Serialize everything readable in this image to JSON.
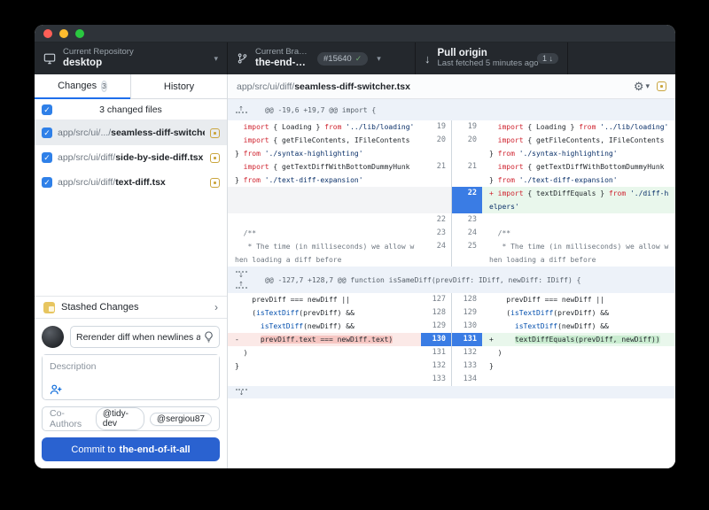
{
  "colors": {
    "accent_blue": "#1f6feb",
    "commit_button_blue": "#2a62d0",
    "added_bg": "#e9f7ec",
    "deleted_bg": "#fbe9e7",
    "modified_icon_yellow": "#caa53d",
    "line_number_highlight": "#3a7ce4",
    "toolbar_bg": "#24282d"
  },
  "icons": {
    "gear": "⚙",
    "caret_down": "▾",
    "chevron_right": "›",
    "check": "✓",
    "arrow_down": "↓",
    "arrow_up": "↑"
  },
  "toolbar": {
    "repo": {
      "label": "Current Repository",
      "value": "desktop"
    },
    "branch": {
      "label": "Current Bra…",
      "value": "the-end-of…",
      "pr_number": "#15640"
    },
    "pull": {
      "title": "Pull origin",
      "subtitle": "Last fetched 5 minutes ago",
      "badge_count": "1"
    }
  },
  "sidebar": {
    "tabs": {
      "changes": "Changes",
      "changes_badge": "3",
      "history": "History"
    },
    "files_header": "3 changed files",
    "files": [
      {
        "path_dim": "app/src/ui/.../",
        "path_file": "seamless-diff-switcher.tsx",
        "selected": true
      },
      {
        "path_dim": "app/src/ui/diff/",
        "path_file": "side-by-side-diff.tsx",
        "selected": false
      },
      {
        "path_dim": "app/src/ui/diff/",
        "path_file": "text-diff.tsx",
        "selected": false
      }
    ],
    "stash": {
      "label": "Stashed Changes"
    }
  },
  "commit": {
    "summary_value": "Rerender diff when newlines are adde",
    "description_placeholder": "Description",
    "coauthors_label": "Co-Authors",
    "coauthors": [
      "@tidy-dev",
      "@sergiou87"
    ],
    "button_prefix": "Commit to",
    "button_branch": "the-end-of-it-all"
  },
  "diff": {
    "header": {
      "path_dim": "app/src/ui/diff/",
      "path_file": "seamless-diff-switcher.tsx"
    },
    "rows": [
      {
        "t": "hunk",
        "exp": [
          "up"
        ],
        "h": 24,
        "text": "@@ -19,6 +19,7 @@ import {"
      },
      {
        "t": "line",
        "n": 1,
        "old": "19",
        "new": "19",
        "l": {
          "s": "ctx",
          "segs": [
            [
              "  ",
              "p"
            ],
            [
              "import",
              "k"
            ],
            [
              " { Loading } ",
              "p"
            ],
            [
              "from",
              "k"
            ],
            [
              " ",
              "p"
            ],
            [
              "'../lib/loading'",
              "s"
            ]
          ]
        },
        "r": {
          "s": "ctx",
          "segs": [
            [
              "  ",
              "p"
            ],
            [
              "import",
              "k"
            ],
            [
              " { Loading } ",
              "p"
            ],
            [
              "from",
              "k"
            ],
            [
              " ",
              "p"
            ],
            [
              "'../lib/loading'",
              "s"
            ]
          ]
        }
      },
      {
        "t": "line",
        "n": 2,
        "old": "20",
        "new": "20",
        "l": {
          "s": "ctx",
          "segs": [
            [
              "  ",
              "p"
            ],
            [
              "import",
              "k"
            ],
            [
              " { getFileContents, IFileContents\n} ",
              "p"
            ],
            [
              "from",
              "k"
            ],
            [
              " ",
              "p"
            ],
            [
              "'./syntax-highlighting'",
              "s"
            ]
          ]
        },
        "r": {
          "s": "ctx",
          "segs": [
            [
              "  ",
              "p"
            ],
            [
              "import",
              "k"
            ],
            [
              " { getFileContents, IFileContents\n} ",
              "p"
            ],
            [
              "from",
              "k"
            ],
            [
              " ",
              "p"
            ],
            [
              "'./syntax-highlighting'",
              "s"
            ]
          ]
        }
      },
      {
        "t": "line",
        "n": 2,
        "old": "21",
        "new": "21",
        "l": {
          "s": "ctx",
          "segs": [
            [
              "  ",
              "p"
            ],
            [
              "import",
              "k"
            ],
            [
              " { getTextDiffWithBottomDummyHunk\n} ",
              "p"
            ],
            [
              "from",
              "k"
            ],
            [
              " ",
              "p"
            ],
            [
              "'./text-diff-expansion'",
              "s"
            ]
          ]
        },
        "r": {
          "s": "ctx",
          "segs": [
            [
              "  ",
              "p"
            ],
            [
              "import",
              "k"
            ],
            [
              " { getTextDiffWithBottomDummyHunk\n} ",
              "p"
            ],
            [
              "from",
              "k"
            ],
            [
              " ",
              "p"
            ],
            [
              "'./text-diff-expansion'",
              "s"
            ]
          ]
        }
      },
      {
        "t": "line",
        "n": 2,
        "old": "",
        "new": "22",
        "numhl": true,
        "l": {
          "s": "empty",
          "segs": []
        },
        "r": {
          "s": "add",
          "segs": [
            [
              "+ ",
              "k"
            ],
            [
              "import",
              "k"
            ],
            [
              " { textDiffEquals } ",
              "p"
            ],
            [
              "from",
              "k"
            ],
            [
              " ",
              "p"
            ],
            [
              "'./diff-h\nelpers'",
              "s"
            ]
          ]
        }
      },
      {
        "t": "line",
        "n": 1,
        "old": "22",
        "new": "23",
        "l": {
          "s": "ctx",
          "segs": []
        },
        "r": {
          "s": "ctx",
          "segs": []
        }
      },
      {
        "t": "line",
        "n": 1,
        "old": "23",
        "new": "24",
        "l": {
          "s": "ctx",
          "segs": [
            [
              "  /**",
              "c"
            ]
          ]
        },
        "r": {
          "s": "ctx",
          "segs": [
            [
              "  /**",
              "c"
            ]
          ]
        }
      },
      {
        "t": "line",
        "n": 2,
        "old": "24",
        "new": "25",
        "l": {
          "s": "ctx",
          "segs": [
            [
              "   * The time (in milliseconds) we allow w\nhen loading a diff before",
              "c"
            ]
          ]
        },
        "r": {
          "s": "ctx",
          "segs": [
            [
              "   * The time (in milliseconds) we allow w\nhen loading a diff before",
              "c"
            ]
          ]
        }
      },
      {
        "t": "hunk",
        "exp": [
          "down",
          "up"
        ],
        "h": 30,
        "text": "@@ -127,7 +128,7 @@ function isSameDiff(prevDiff: IDiff, newDiff: IDiff) {"
      },
      {
        "t": "line",
        "n": 1,
        "old": "127",
        "new": "128",
        "l": {
          "s": "ctx",
          "segs": [
            [
              "    prevDiff === newDiff ||",
              "p"
            ]
          ]
        },
        "r": {
          "s": "ctx",
          "segs": [
            [
              "    prevDiff === newDiff ||",
              "p"
            ]
          ]
        }
      },
      {
        "t": "line",
        "n": 1,
        "old": "128",
        "new": "129",
        "l": {
          "s": "ctx",
          "segs": [
            [
              "    (",
              "p"
            ],
            [
              "isTextDiff",
              "f"
            ],
            [
              "(prevDiff) &&",
              "p"
            ]
          ]
        },
        "r": {
          "s": "ctx",
          "segs": [
            [
              "    (",
              "p"
            ],
            [
              "isTextDiff",
              "f"
            ],
            [
              "(prevDiff) &&",
              "p"
            ]
          ]
        }
      },
      {
        "t": "line",
        "n": 1,
        "old": "129",
        "new": "130",
        "l": {
          "s": "ctx",
          "segs": [
            [
              "      ",
              "p"
            ],
            [
              "isTextDiff",
              "f"
            ],
            [
              "(newDiff) &&",
              "p"
            ]
          ]
        },
        "r": {
          "s": "ctx",
          "segs": [
            [
              "      ",
              "p"
            ],
            [
              "isTextDiff",
              "f"
            ],
            [
              "(newDiff) &&",
              "p"
            ]
          ]
        }
      },
      {
        "t": "line",
        "n": 1,
        "old": "130",
        "new": "131",
        "numhl": true,
        "l": {
          "s": "del",
          "segs": [
            [
              "-     ",
              "p"
            ],
            [
              "prevDiff.text === newDiff.text)",
              "p hl-del"
            ]
          ]
        },
        "r": {
          "s": "add",
          "segs": [
            [
              "+     ",
              "p"
            ],
            [
              "textDiffEquals(prevDiff, newDiff))",
              "p hl-add"
            ]
          ]
        }
      },
      {
        "t": "line",
        "n": 1,
        "old": "131",
        "new": "132",
        "l": {
          "s": "ctx",
          "segs": [
            [
              "  )",
              "p"
            ]
          ]
        },
        "r": {
          "s": "ctx",
          "segs": [
            [
              "  )",
              "p"
            ]
          ]
        }
      },
      {
        "t": "line",
        "n": 1,
        "old": "132",
        "new": "133",
        "l": {
          "s": "ctx",
          "segs": [
            [
              "}",
              "p"
            ]
          ]
        },
        "r": {
          "s": "ctx",
          "segs": [
            [
              "}",
              "p"
            ]
          ]
        }
      },
      {
        "t": "line",
        "n": 1,
        "old": "133",
        "new": "134",
        "l": {
          "s": "ctx",
          "segs": []
        },
        "r": {
          "s": "ctx",
          "segs": []
        }
      },
      {
        "t": "expandrow"
      }
    ]
  }
}
